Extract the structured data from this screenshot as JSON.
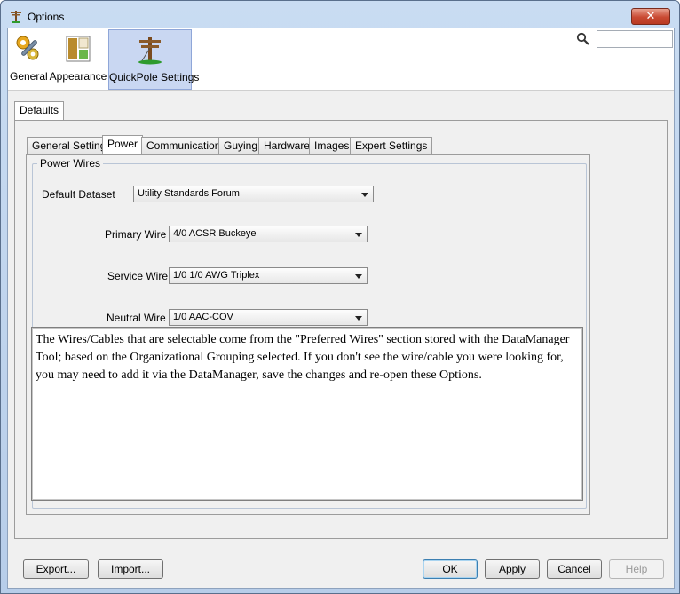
{
  "window": {
    "title": "Options",
    "close_glyph": "✕"
  },
  "categories": [
    {
      "label": "General",
      "icon": "gears-wrench-icon"
    },
    {
      "label": "Appearance",
      "icon": "appearance-icon"
    },
    {
      "label": "QuickPole Settings",
      "icon": "utility-pole-icon",
      "selected": true
    }
  ],
  "search": {
    "value": "",
    "placeholder": ""
  },
  "outer_tabs": [
    {
      "label": "Defaults",
      "active": true
    }
  ],
  "inner_tabs": [
    {
      "label": "General Settings"
    },
    {
      "label": "Power",
      "active": true
    },
    {
      "label": "Communications"
    },
    {
      "label": "Guying"
    },
    {
      "label": "Hardware"
    },
    {
      "label": "Images"
    },
    {
      "label": "Expert Settings"
    }
  ],
  "power": {
    "group_title": "Power Wires",
    "fields": [
      {
        "label": "Default Dataset",
        "value": "Utility Standards Forum"
      },
      {
        "label": "Primary Wire",
        "value": "4/0 ACSR Buckeye"
      },
      {
        "label": "Service Wire",
        "value": "1/0 1/0 AWG Triplex"
      },
      {
        "label": "Neutral Wire",
        "value": "1/0 AAC-COV"
      }
    ],
    "note": "The Wires/Cables that are selectable come from the \"Preferred Wires\" section stored with the DataManager Tool; based on the Organizational Grouping selected. If you don't see the wire/cable you were looking for, you may need to add it via the DataManager, save the changes and re-open these Options."
  },
  "buttons": {
    "export": "Export...",
    "import": "Import...",
    "ok": "OK",
    "apply": "Apply",
    "cancel": "Cancel",
    "help": "Help"
  },
  "colors": {
    "selected_category_bg": "#c9d7f2",
    "close_button": "#c94a33"
  }
}
